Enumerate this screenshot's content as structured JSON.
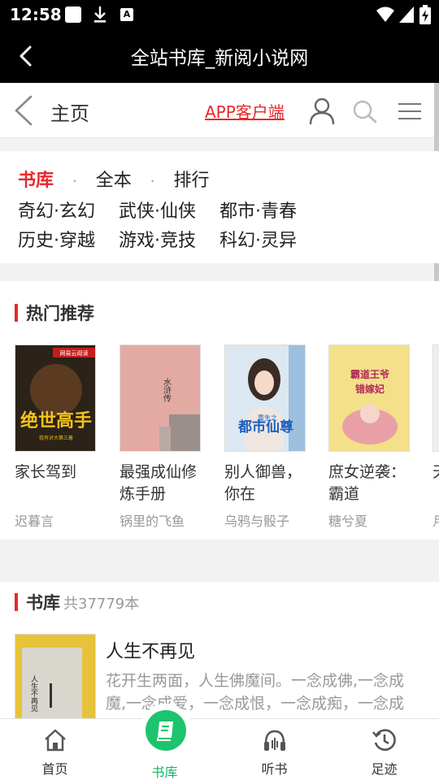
{
  "status": {
    "time": "12:58",
    "a_icon_letter": "A"
  },
  "titlebar": {
    "title": "全站书库_新阅小说网"
  },
  "header": {
    "title": "主页",
    "app_link": "APP客户端"
  },
  "categories": {
    "row1": [
      "书库",
      "全本",
      "排行"
    ],
    "row2": [
      "奇幻·玄幻",
      "武侠·仙侠",
      "都市·青春"
    ],
    "row3": [
      "历史·穿越",
      "游戏·竞技",
      "科幻·灵异"
    ]
  },
  "hot": {
    "title": "热门推荐",
    "books": [
      {
        "title": "家长驾到",
        "author": "迟暮言",
        "cover_text": "绝世高手",
        "cover_sub": "我有对大第三着",
        "cover_badge": "网易云阅读",
        "color": "#2b2218"
      },
      {
        "title": "最强成仙修炼手册",
        "author": "锅里的飞鱼",
        "cover_text": "水浒传",
        "color": "#e3aaa4"
      },
      {
        "title": "别人御兽，你在",
        "author": "乌鸦与骰子",
        "cover_text": "都市仙尊",
        "cover_sub": "重生之",
        "color": "#dce8f1"
      },
      {
        "title": "庶女逆袭：霸道",
        "author": "糖兮夏",
        "cover_text": "霸道王爷错嫁妃",
        "color": "#f3e089"
      },
      {
        "title": "天的",
        "author": "月",
        "color": "#eeeeee"
      }
    ]
  },
  "library": {
    "title": "书库",
    "count": "共37779本",
    "book": {
      "title": "人生不再见",
      "desc": "花开生两面，人生佛魔间。一念成佛,一念成魔,一念成爱，一念成恨，一念成痴，一念成执",
      "cover_text": "人生不再见"
    }
  },
  "nav": [
    {
      "label": "首页",
      "icon": "home-icon"
    },
    {
      "label": "书库",
      "icon": "book-icon"
    },
    {
      "label": "听书",
      "icon": "headphones-icon"
    },
    {
      "label": "足迹",
      "icon": "history-icon"
    }
  ],
  "colors": {
    "accent": "#e8282b",
    "nav_active": "#19b367",
    "titlebar": "#000000"
  }
}
